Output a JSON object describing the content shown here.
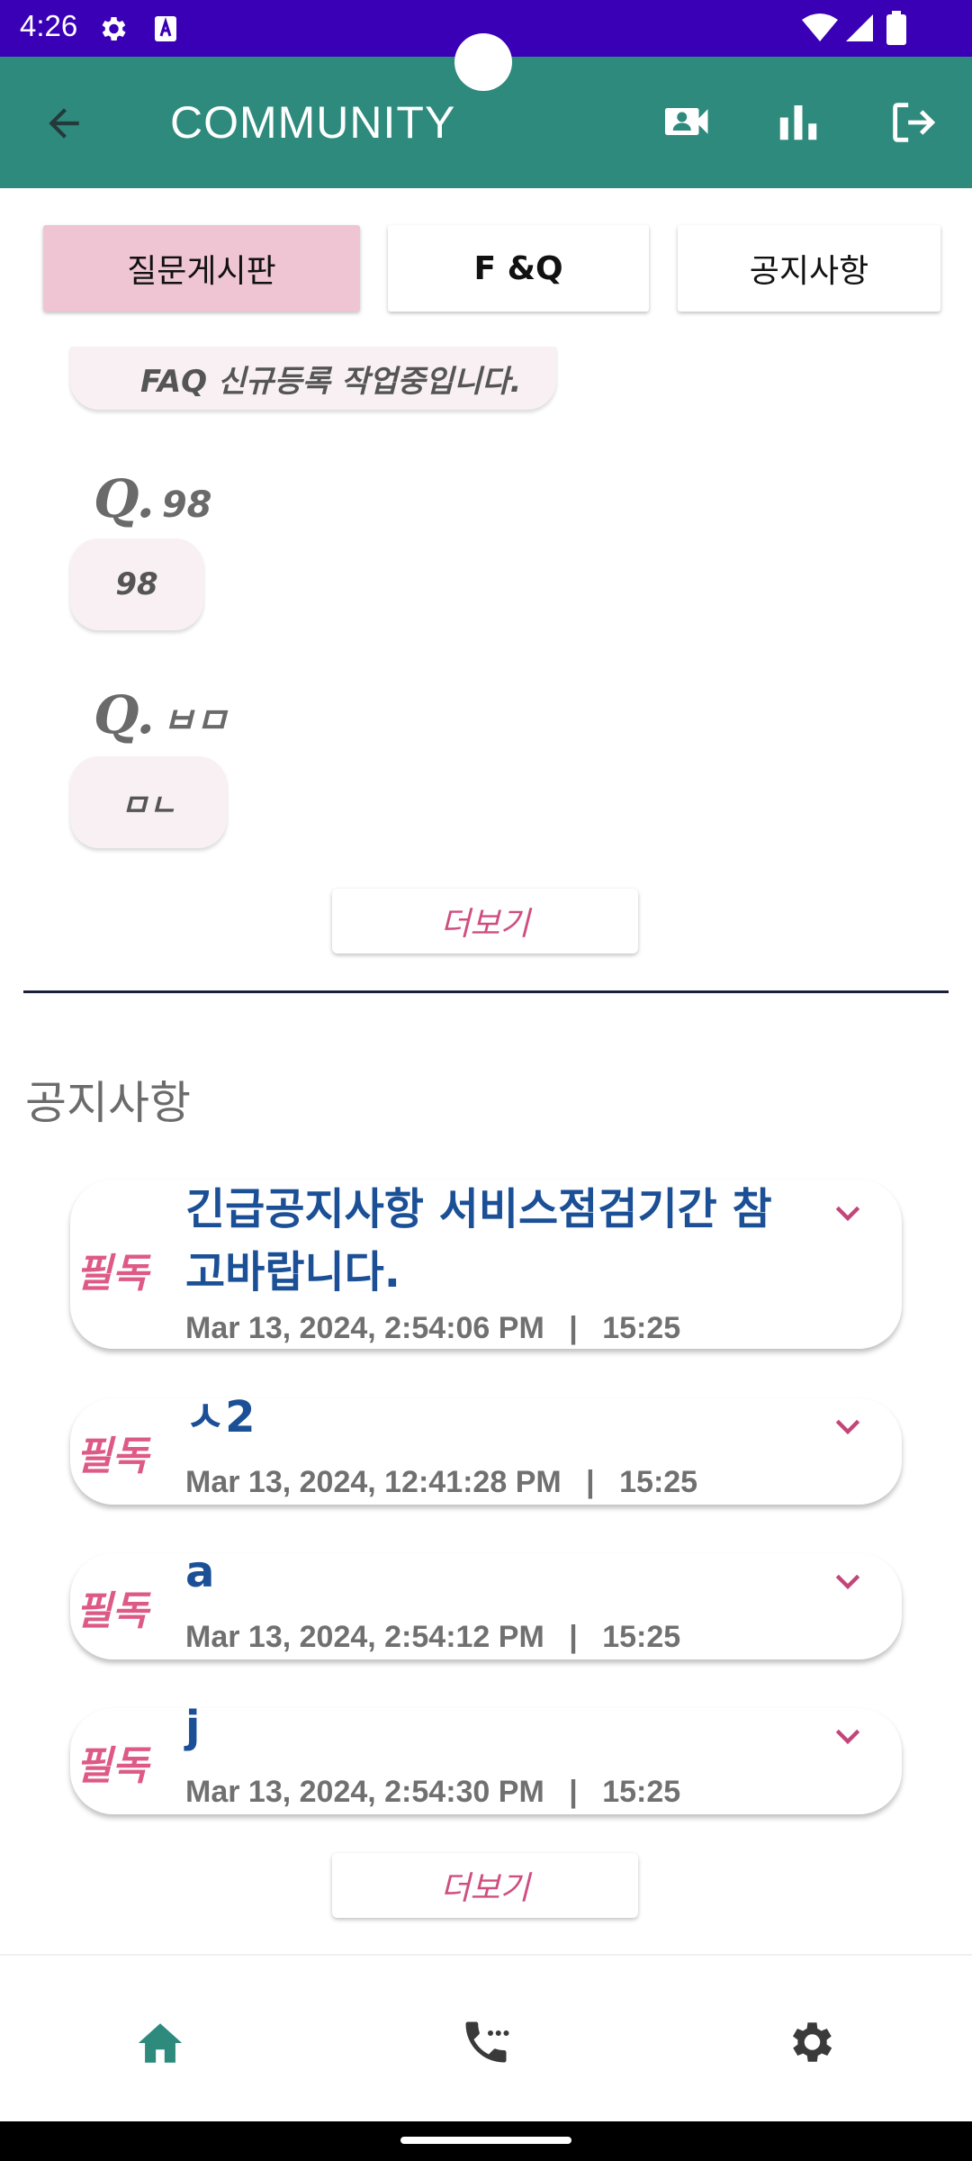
{
  "status": {
    "time": "4:26"
  },
  "appbar": {
    "title": "COMMUNITY"
  },
  "tabs": [
    {
      "label": "질문게시판"
    },
    {
      "label": "F &Q"
    },
    {
      "label": "공지사항"
    }
  ],
  "faq": {
    "partial_answer": "FAQ 신규등록 작업중입니다.",
    "items": [
      {
        "q_prefix": "Q.",
        "question": "98",
        "answer": "98"
      },
      {
        "q_prefix": "Q.",
        "question": "ㅂㅁ",
        "answer": "ㅁㄴ"
      }
    ],
    "more_label": "더보기"
  },
  "notices": {
    "section_title": "공지사항",
    "items": [
      {
        "badge": "필독",
        "title": "긴급공지사항 서비스점검기간 참고바랍니다.",
        "date": "Mar 13, 2024, 2:54:06 PM",
        "separator": "|",
        "time": "15:25"
      },
      {
        "badge": "필독",
        "title": "ㅅ2",
        "date": "Mar 13, 2024, 12:41:28 PM",
        "separator": "|",
        "time": "15:25"
      },
      {
        "badge": "필독",
        "title": "a",
        "date": "Mar 13, 2024, 2:54:12 PM",
        "separator": "|",
        "time": "15:25"
      },
      {
        "badge": "필독",
        "title": "j",
        "date": "Mar 13, 2024, 2:54:30 PM",
        "separator": "|",
        "time": "15:25"
      }
    ],
    "more_label": "더보기"
  },
  "colors": {
    "status_bar": "#3a00b5",
    "app_bar": "#2d8a7c",
    "active_tab": "#efc5d4",
    "accent_pink": "#dd5a87",
    "notice_title": "#1b4f96"
  },
  "icons": {
    "appbar": [
      "back-arrow-icon",
      "video-user-icon",
      "bar-chart-icon",
      "logout-icon"
    ],
    "bottomnav": [
      "home-icon",
      "phone-icon",
      "settings-icon"
    ]
  }
}
